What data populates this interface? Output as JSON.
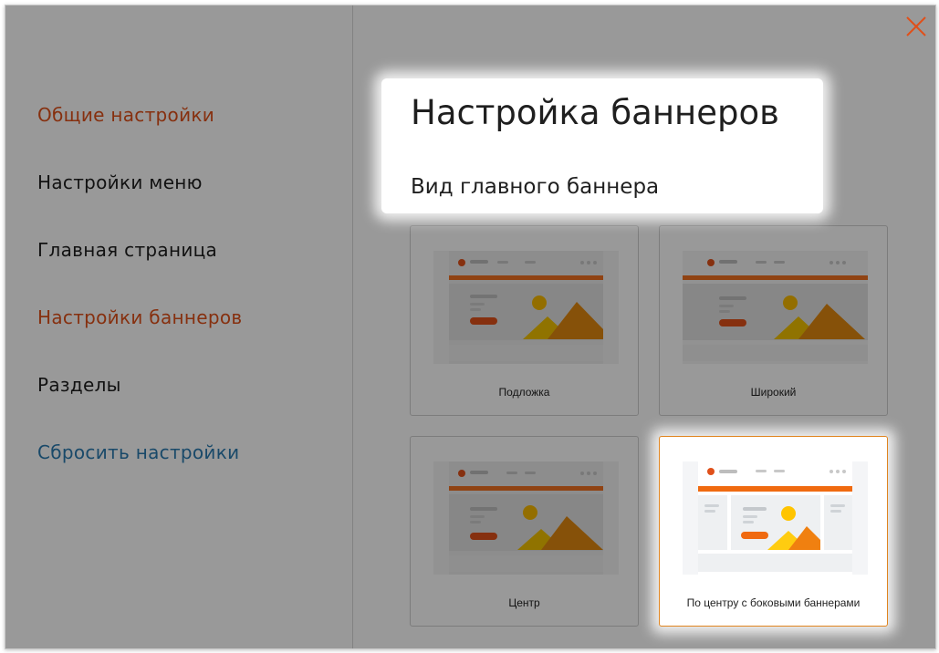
{
  "colors": {
    "accent_orange": "#e0501a",
    "link_blue": "#2a7ab0",
    "text_dark": "#1f1f1f",
    "selected_border": "#e0841e"
  },
  "sidebar": {
    "items": [
      {
        "label": "Общие настройки",
        "color": "#e0501a"
      },
      {
        "label": "Настройки меню",
        "color": "#1f1f1f"
      },
      {
        "label": "Главная страница",
        "color": "#1f1f1f"
      },
      {
        "label": "Настройки баннеров",
        "color": "#e0501a"
      },
      {
        "label": "Разделы",
        "color": "#1f1f1f"
      },
      {
        "label": "Сбросить настройки",
        "color": "#2a7ab0"
      }
    ]
  },
  "main": {
    "title": "Настройка баннеров",
    "subtitle": "Вид главного баннера",
    "options": [
      {
        "label": "Подложка"
      },
      {
        "label": "Широкий"
      },
      {
        "label": "Центр"
      },
      {
        "label": "По центру с боковыми баннерами",
        "selected": true
      }
    ]
  },
  "close_icon": "close-icon"
}
